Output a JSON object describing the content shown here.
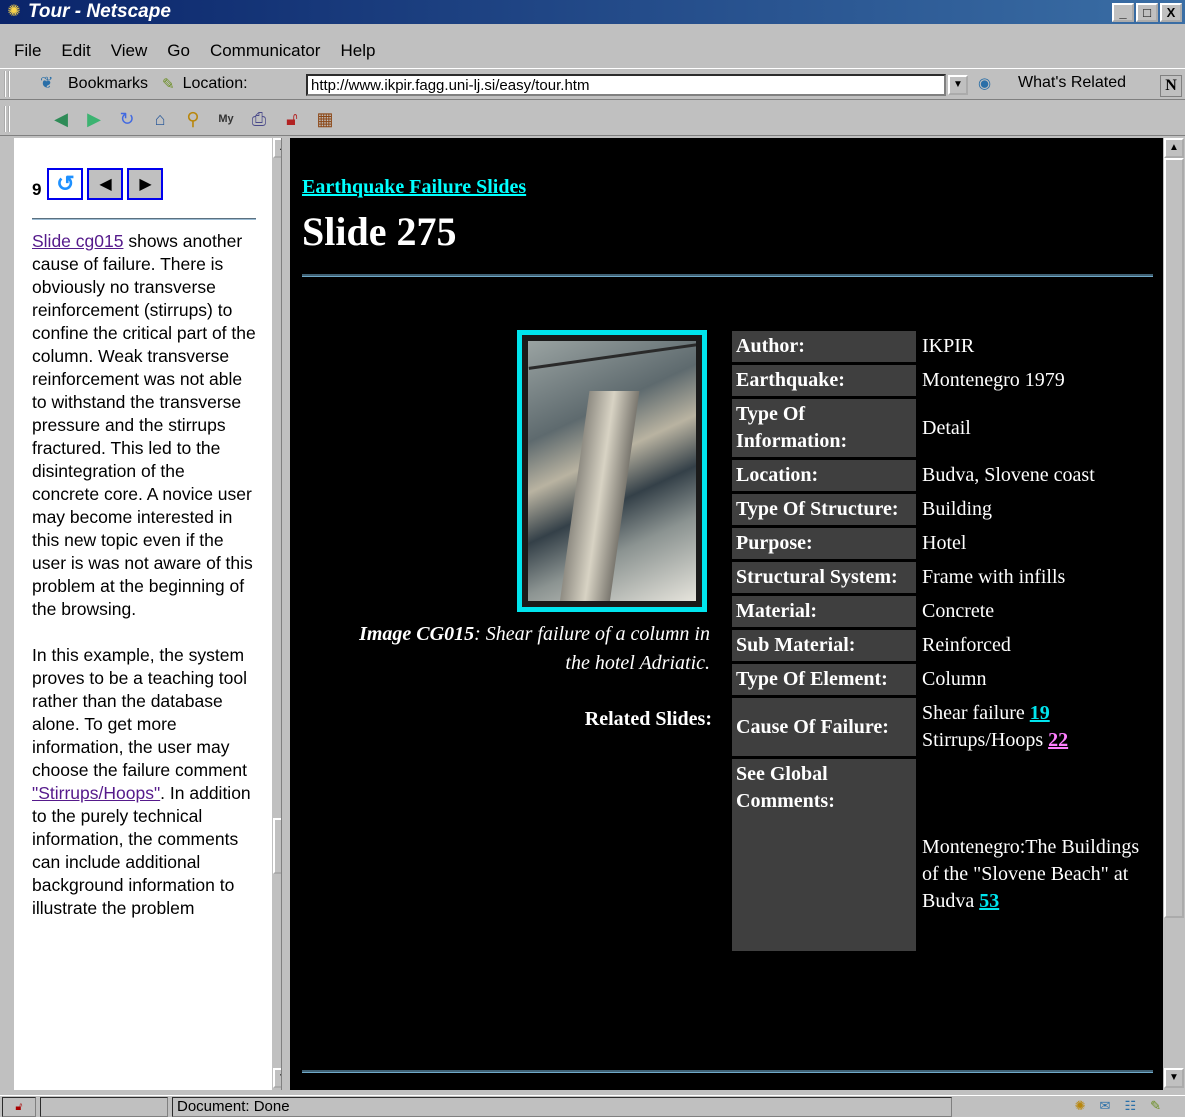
{
  "window": {
    "title": "Tour - Netscape",
    "buttons": [
      "_",
      "□",
      "X"
    ]
  },
  "menu": [
    "File",
    "Edit",
    "View",
    "Go",
    "Communicator",
    "Help"
  ],
  "location_bar": {
    "bookmarks_label": "Bookmarks",
    "location_label": "Location:",
    "url": "http://www.ikpir.fagg.uni-lj.si/easy/tour.htm",
    "related_label": "What's Related",
    "n_logo": "N"
  },
  "nav_toolbar": {
    "icons": [
      "back-icon",
      "forward-icon",
      "reload-icon",
      "home-icon",
      "search-icon",
      "my-netscape-icon",
      "print-icon",
      "security-icon",
      "stop-icon"
    ],
    "my_label": "My"
  },
  "tour": {
    "step_number": "9",
    "paragraphs": [
      {
        "link": "Slide cg015",
        "text": " shows another cause of failure. There is obviously no transverse reinforcement (stirrups) to confine the critical part of the column. Weak transverse reinforcement was not able to withstand the transverse pressure and the stirrups fractured. This led to the disintegration of the concrete core. A novice user may become interested in this new topic even if the user is was not aware of this problem at the beginning of the browsing."
      },
      {
        "pre": "In this example, the system proves to be a teaching tool rather than the database alone. To get more information, the user may choose the failure comment ",
        "link": "\"Stirrups/Hoops\"",
        "post": ". In addition to the purely technical information, the comments can include additional background information to illustrate the problem"
      }
    ]
  },
  "slide": {
    "category": "Earthquake Failure Slides",
    "title": "Slide 275",
    "image_label": "Image CG015",
    "caption": ": Shear failure of a column in the hotel Adriatic.",
    "related_label": "Related Slides:",
    "rows": [
      {
        "key": "Author:",
        "value": "IKPIR"
      },
      {
        "key": "Earthquake:",
        "value": "Montenegro 1979"
      },
      {
        "key": "Type Of Information:",
        "value": "Detail"
      },
      {
        "key": "Location:",
        "value": "Budva, Slovene coast"
      },
      {
        "key": "Type Of Structure:",
        "value": "Building"
      },
      {
        "key": "Purpose:",
        "value": "Hotel"
      },
      {
        "key": "Structural System:",
        "value": "Frame with infills"
      },
      {
        "key": "Material:",
        "value": "Concrete"
      },
      {
        "key": "Sub Material:",
        "value": "Reinforced"
      },
      {
        "key": "Type Of Element:",
        "value": "Column"
      }
    ],
    "cause": {
      "key": "Cause Of Failure:",
      "line1_text": "Shear failure ",
      "line1_link": "19",
      "line2_text": "Stirrups/Hoops ",
      "line2_link": "22"
    },
    "global": {
      "key": "See Global Comments:",
      "text": "Montenegro:The Buildings of the \"Slovene Beach\" at Budva ",
      "link": "53"
    }
  },
  "status": {
    "text": "Document: Done"
  },
  "colors": {
    "link_cyan": "#00e5ee",
    "link_visited_pink": "#ff7fff",
    "page_bg": "#000000",
    "key_cell_bg": "#3f3f3f"
  }
}
